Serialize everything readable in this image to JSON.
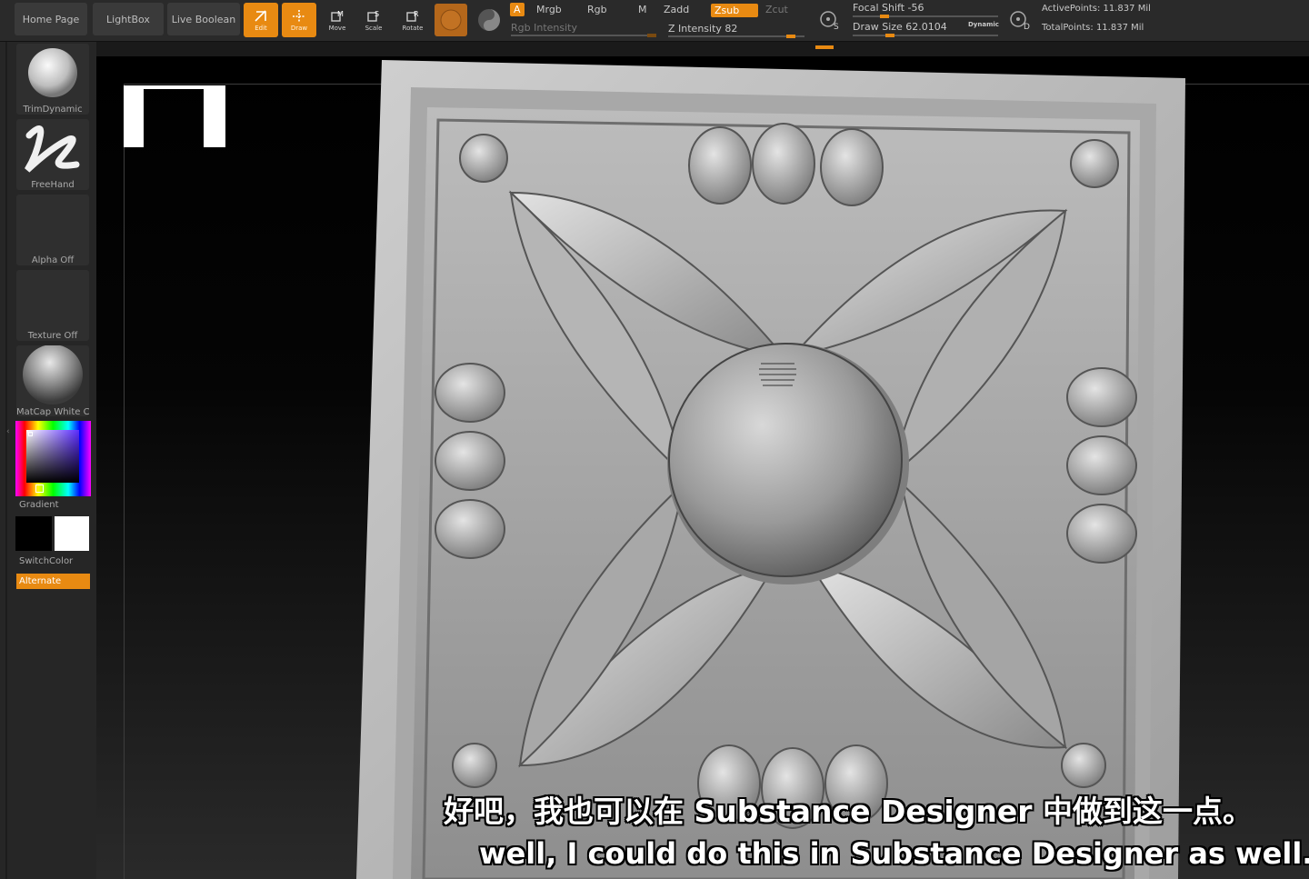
{
  "toolbar": {
    "home_page": "Home Page",
    "lightbox": "LightBox",
    "live_boolean": "Live Boolean",
    "edit": "Edit",
    "draw": "Draw",
    "move": "Move",
    "scale": "Scale",
    "rotate": "Rotate",
    "a_label": "A",
    "mrgb": "Mrgb",
    "rgb": "Rgb",
    "m": "M",
    "zadd": "Zadd",
    "zsub": "Zsub",
    "zcut": "Zcut",
    "rgb_intensity": "Rgb Intensity",
    "z_intensity": "Z Intensity 82",
    "focal_shift": "Focal Shift -56",
    "draw_size": "Draw Size 62.0104",
    "dynamic": "Dynamic",
    "active_points": "ActivePoints: 11.837 Mil",
    "total_points": "TotalPoints: 11.837 Mil"
  },
  "shelf": {
    "brush": "TrimDynamic",
    "stroke": "FreeHand",
    "alpha": "Alpha Off",
    "texture": "Texture Off",
    "material": "MatCap White C",
    "gradient": "Gradient",
    "switch_color": "SwitchColor",
    "alternate": "Alternate"
  },
  "subtitles": {
    "chinese": "好吧，我也可以在 Substance Designer 中做到这一点。",
    "english": "well, I could do this in Substance Designer as well."
  },
  "colors": {
    "accent": "#e88a12",
    "background": "#1a1a1a",
    "panel": "#2a2a2a"
  }
}
